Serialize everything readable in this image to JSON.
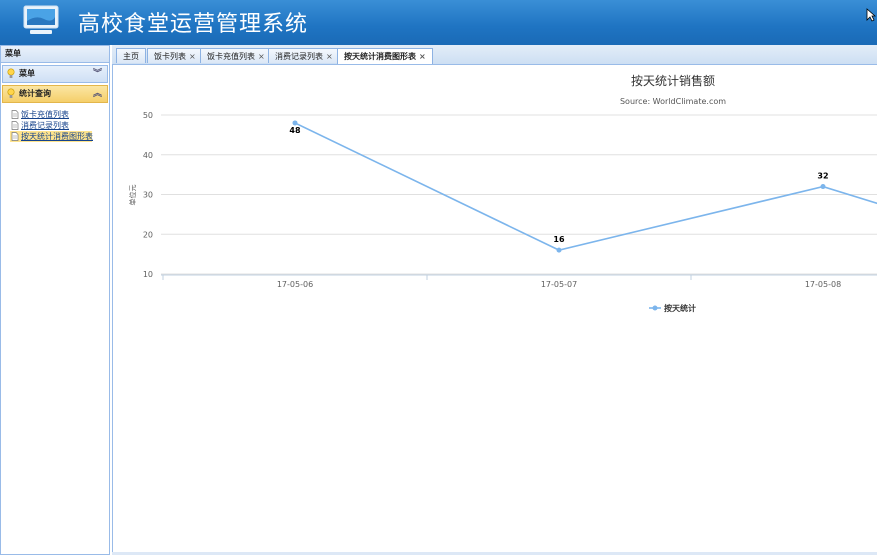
{
  "header": {
    "title": "高校食堂运营管理系统"
  },
  "sidebar": {
    "title": "菜单",
    "sections": [
      {
        "label": "菜单"
      },
      {
        "label": "统计查询"
      }
    ],
    "items": [
      {
        "label": "饭卡充值列表"
      },
      {
        "label": "消费记录列表"
      },
      {
        "label": "按天统计消费图形表"
      }
    ]
  },
  "tabs": [
    {
      "label": "主页"
    },
    {
      "label": "饭卡列表"
    },
    {
      "label": "饭卡充值列表"
    },
    {
      "label": "消费记录列表"
    },
    {
      "label": "按天统计消费图形表"
    }
  ],
  "tab_close_glyph": "×",
  "chart_data": {
    "type": "line",
    "title": "按天统计销售额",
    "subtitle": "Source: WorldClimate.com",
    "ylabel": "单位元",
    "ylim": [
      10,
      50
    ],
    "yticks": [
      "50",
      "40",
      "30",
      "20",
      "10"
    ],
    "categories": [
      "17-05-06",
      "17-05-07",
      "17-05-08"
    ],
    "series": [
      {
        "name": "按天统计",
        "values": [
          48,
          16,
          32
        ],
        "color": "#7cb5ec"
      }
    ],
    "data_labels": [
      "48",
      "16",
      "32"
    ],
    "legend_position": "bottom"
  }
}
